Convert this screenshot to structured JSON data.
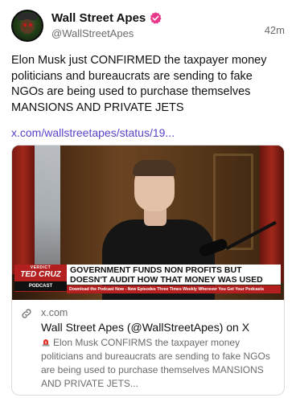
{
  "post": {
    "display_name": "Wall Street Apes",
    "handle": "@WallStreetApes",
    "timestamp": "42m",
    "verified_icon": "verified-badge-icon",
    "verified_color": "#e8388a",
    "body": "Elon Musk just CONFIRMED the taxpayer money politicians and bureaucrats are sending to fake NGOs are being used to purchase themselves MANSIONS AND PRIVATE JETS",
    "link_text": "x.com/wallstreetapes/status/19...",
    "link_color": "#5b40c8"
  },
  "card": {
    "media": {
      "badge_top": "VERDICT",
      "badge_name": "TED CRUZ",
      "badge_bottom": "PODCAST",
      "headline": "GOVERNMENT FUNDS NON PROFITS BUT DOESN'T AUDIT HOW THAT MONEY WAS USED",
      "ticker": "Download the Podcast Now - New Episodes Three Times Weekly Wherever You Get Your Podcasts"
    },
    "domain": "x.com",
    "title": "Wall Street Apes (@WallStreetApes) on X",
    "description_icon": "rotating-light-icon",
    "description": "Elon Musk CONFIRMS the taxpayer money politicians and bureaucrats are sending to fake NGOs are being used to purchase themselves MANSIONS AND PRIVATE JETS..."
  }
}
